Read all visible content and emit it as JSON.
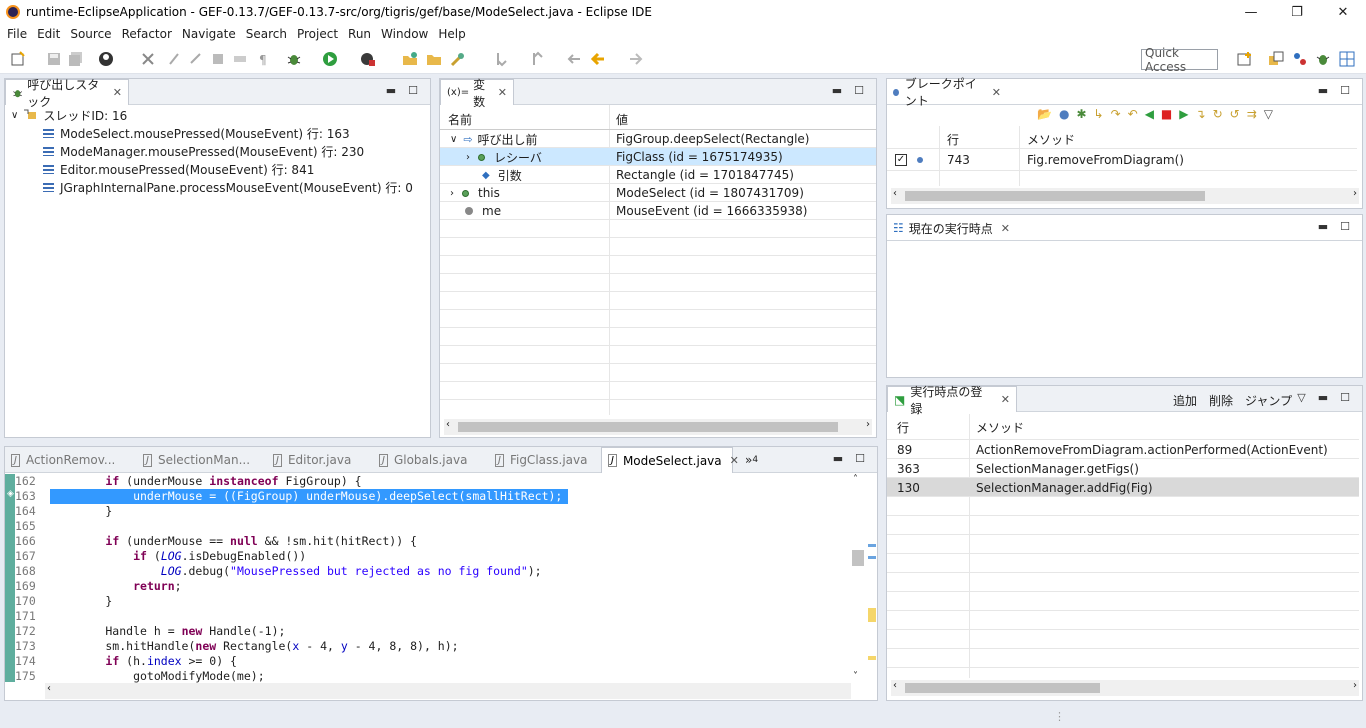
{
  "window": {
    "title": "runtime-EclipseApplication - GEF-0.13.7/GEF-0.13.7-src/org/tigris/gef/base/ModeSelect.java - Eclipse IDE",
    "minimize": "—",
    "restore": "❐",
    "close": "✕"
  },
  "menu": {
    "items": [
      "File",
      "Edit",
      "Source",
      "Refactor",
      "Navigate",
      "Search",
      "Project",
      "Run",
      "Window",
      "Help"
    ],
    "mnemonics": [
      "F",
      "E",
      "S",
      "t",
      "N",
      "a",
      "P",
      "R",
      "W",
      "H"
    ]
  },
  "toolbar": {
    "quick_access": "Quick Access"
  },
  "callstack": {
    "tab_label": "呼び出しスタック",
    "thread_label": "スレッドID: 16",
    "frames": [
      "ModeSelect.mousePressed(MouseEvent) 行: 163",
      "ModeManager.mousePressed(MouseEvent) 行: 230",
      "Editor.mousePressed(MouseEvent) 行: 841",
      "JGraphInternalPane.processMouseEvent(MouseEvent) 行: 0"
    ]
  },
  "variables": {
    "tab_prefix": "(x)=",
    "tab_label": "変数",
    "col_name": "名前",
    "col_value": "値",
    "rows": [
      {
        "name": "呼び出し前",
        "value": "FigGroup.deepSelect(Rectangle)"
      },
      {
        "name": "レシーバ",
        "value": "FigClass (id = 1675174935)"
      },
      {
        "name": "引数",
        "value": "Rectangle (id = 1701847745)"
      },
      {
        "name": "this",
        "value": "ModeSelect (id = 1807431709)"
      },
      {
        "name": "me",
        "value": "MouseEvent (id = 1666335938)"
      }
    ]
  },
  "breakpoints": {
    "tab_label": "ブレークポイント",
    "col_line": "行",
    "col_method": "メソッド",
    "rows": [
      {
        "line": "743",
        "method": "Fig.removeFromDiagram()"
      }
    ]
  },
  "current_point": {
    "tab_label": "現在の実行時点"
  },
  "registered_points": {
    "tab_label": "実行時点の登録",
    "actions": [
      "追加",
      "削除",
      "ジャンプ"
    ],
    "col_line": "行",
    "col_method": "メソッド",
    "rows": [
      {
        "line": "89",
        "method": "ActionRemoveFromDiagram.actionPerformed(ActionEvent)"
      },
      {
        "line": "363",
        "method": "SelectionManager.getFigs()"
      },
      {
        "line": "130",
        "method": "SelectionManager.addFig(Fig)"
      }
    ]
  },
  "editor": {
    "tabs": [
      "ActionRemov...",
      "SelectionMan...",
      "Editor.java",
      "Globals.java",
      "FigClass.java",
      "ModeSelect.java"
    ],
    "active_tab": 5,
    "overflow_label": "»",
    "overflow_count": "4",
    "line_numbers": [
      "162",
      "163",
      "164",
      "165",
      "166",
      "167",
      "168",
      "169",
      "170",
      "171",
      "172",
      "173",
      "174",
      "175"
    ]
  },
  "colors": {
    "selection": "#3399ff",
    "row_highlight": "#cce8ff",
    "keyword": "#7f0055",
    "string": "#2a00ff",
    "field": "#0000c0"
  }
}
